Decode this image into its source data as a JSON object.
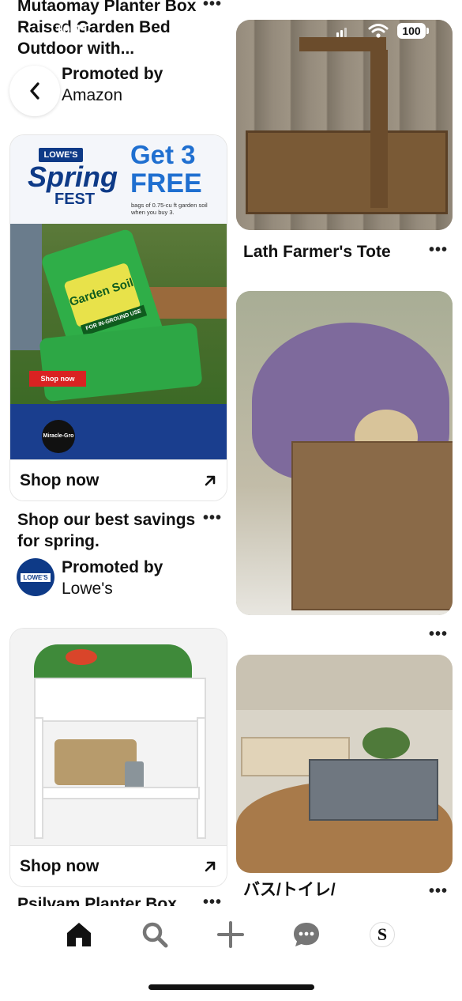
{
  "status_bar": {
    "time": "10:11",
    "battery": "100"
  },
  "pins_left": [
    {
      "title": "Mutaomay Planter Box Raised Garden Bed Outdoor with...",
      "promoted_by": "Promoted by",
      "advertiser": "Amazon"
    },
    {
      "ad": {
        "brand": "LOWE'S",
        "event_line1": "Spring",
        "event_line2": "FEST",
        "headline_line1": "Get 3",
        "headline_line2": "FREE",
        "fine_print": "bags of 0.75-cu ft garden soil when you buy 3.",
        "product_line1": "Garden Soil",
        "product_line2": "FOR IN-GROUND USE",
        "button": "Shop now",
        "footer_brand": "Miracle-Gro"
      },
      "cta": "Shop now",
      "title": "Shop our best savings for spring.",
      "promoted_by": "Promoted by",
      "advertiser": "Lowe's",
      "avatar_text": "LOWE'S"
    },
    {
      "cta": "Shop now",
      "title": "Psilvam Planter Box"
    }
  ],
  "pins_right": [
    {
      "title": "Lath Farmer's Tote"
    },
    {
      "title": ""
    },
    {
      "title": "バス/トイレ/"
    }
  ],
  "more_label": "•••",
  "icons": {
    "back": "chevron-left-icon",
    "external": "arrow-up-right-icon",
    "home": "home-icon",
    "search": "search-icon",
    "create": "plus-icon",
    "messages": "chat-bubble-icon",
    "profile": "profile-avatar"
  },
  "profile_initial": "S",
  "colors": {
    "lowes_blue": "#0e3a87",
    "lowes_light_blue": "#1f6fd0",
    "miracle_green": "#3bb54a"
  }
}
